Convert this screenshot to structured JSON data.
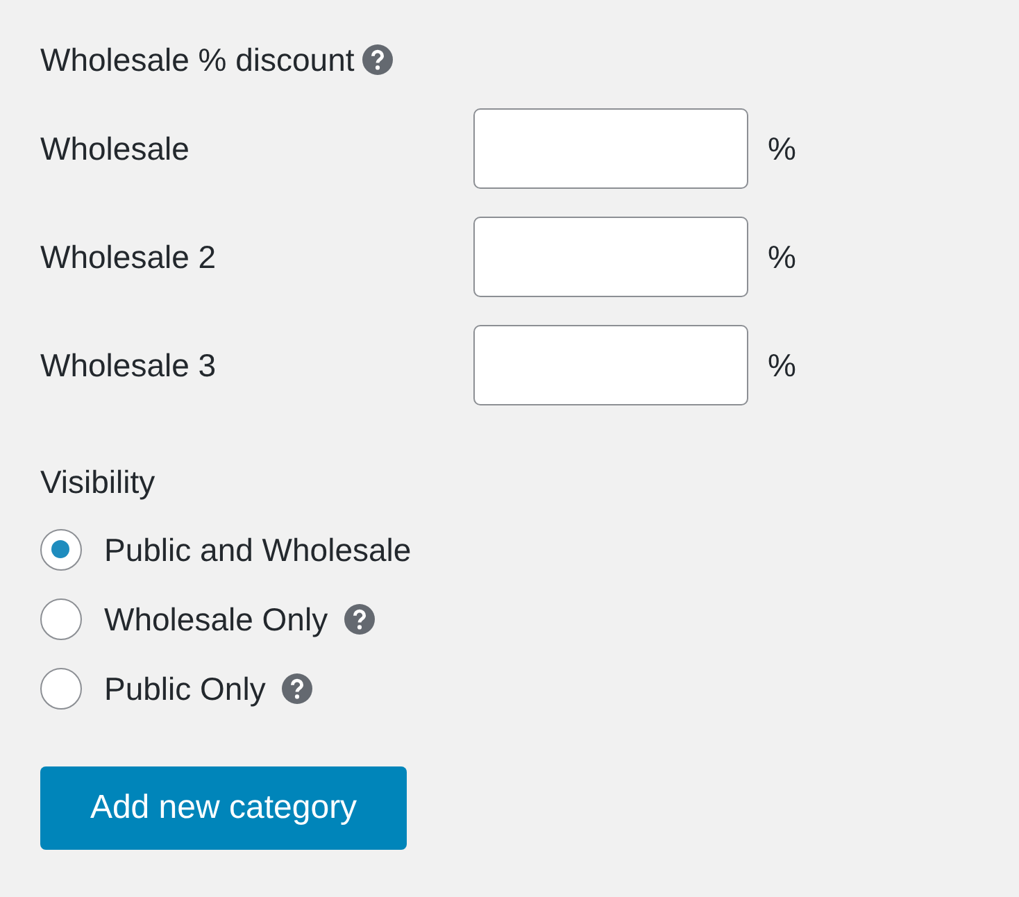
{
  "heading": {
    "text": "Wholesale % discount",
    "help": true
  },
  "discounts": [
    {
      "label": "Wholesale",
      "unit": "%"
    },
    {
      "label": "Wholesale 2",
      "unit": "%"
    },
    {
      "label": "Wholesale 3",
      "unit": "%"
    }
  ],
  "visibility": {
    "label": "Visibility",
    "options": [
      {
        "label": "Public and Wholesale",
        "selected": true,
        "help": false
      },
      {
        "label": "Wholesale Only",
        "selected": false,
        "help": true
      },
      {
        "label": "Public Only",
        "selected": false,
        "help": true
      }
    ]
  },
  "button": "Add new category"
}
